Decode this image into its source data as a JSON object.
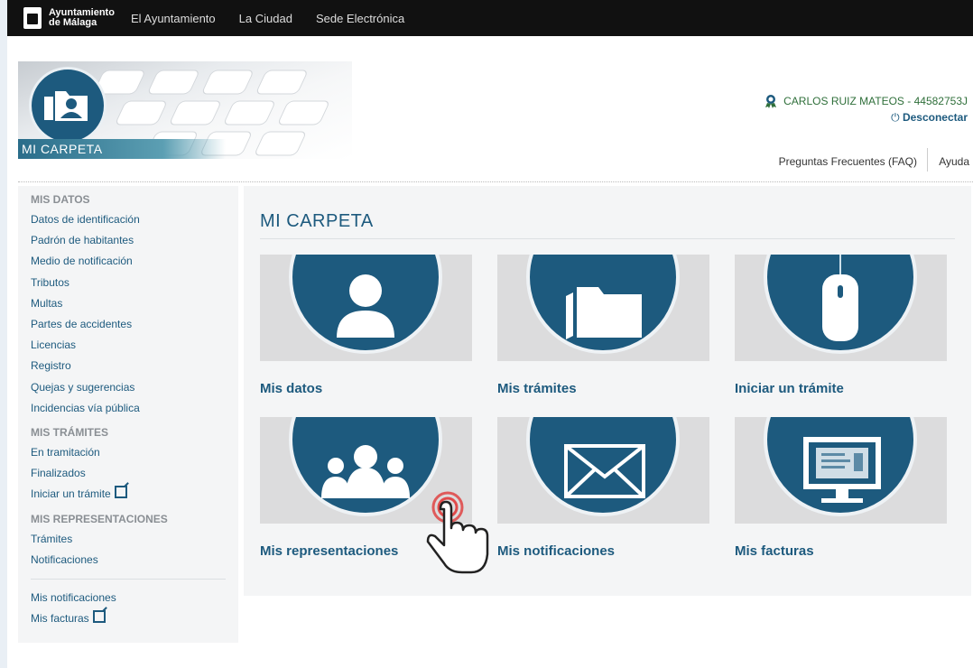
{
  "topbar": {
    "logo_line1": "Ayuntamiento",
    "logo_line2": "de Málaga",
    "nav": [
      "El Ayuntamiento",
      "La Ciudad",
      "Sede Electrónica"
    ]
  },
  "header": {
    "banner_label": "MI CARPETA",
    "user": "CARLOS RUIZ MATEOS - 44582753J",
    "disconnect": "Desconectar",
    "faq": "Preguntas Frecuentes (FAQ)",
    "help": "Ayuda"
  },
  "sidebar": {
    "sec1": "MIS DATOS",
    "items1": [
      "Datos de identificación",
      "Padrón de habitantes",
      "Medio de notificación",
      "Tributos",
      "Multas",
      "Partes de accidentes",
      "Licencias",
      "Registro",
      "Quejas y sugerencias",
      "Incidencias vía pública"
    ],
    "sec2": "MIS TRÁMITES",
    "items2": [
      "En tramitación",
      "Finalizados",
      "Iniciar un trámite"
    ],
    "sec3": "MIS REPRESENTACIONES",
    "items3": [
      "Trámites",
      "Notificaciones"
    ],
    "items4": [
      "Mis notificaciones",
      "Mis facturas"
    ]
  },
  "main": {
    "title": "MI CARPETA",
    "cards": [
      "Mis datos",
      "Mis trámites",
      "Iniciar un trámite",
      "Mis representaciones",
      "Mis notificaciones",
      "Mis facturas"
    ]
  },
  "colors": {
    "primary": "#1d5a7e",
    "tile": "#dcdcdd",
    "user_green": "#2f6f3a"
  }
}
